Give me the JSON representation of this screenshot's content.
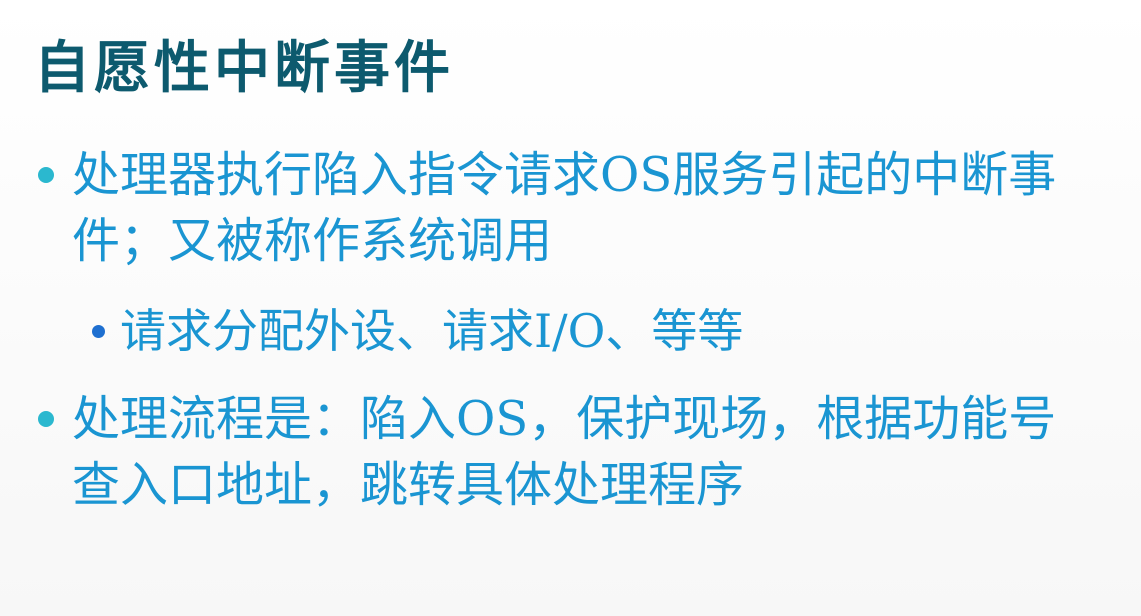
{
  "slide": {
    "title": "自愿性中断事件",
    "bullets": [
      {
        "level": 1,
        "text": "处理器执行陷入指令请求OS服务引起的中断事件；又被称作系统调用"
      },
      {
        "level": 2,
        "text": "请求分配外设、请求I/O、等等"
      },
      {
        "level": 1,
        "text": "处理流程是：陷入OS，保护现场，根据功能号查入口地址，跳转具体处理程序"
      }
    ]
  },
  "colors": {
    "title": "#0d5a6e",
    "body_text": "#1a95d2",
    "bullet_level1": "#2bb8cf",
    "bullet_level2": "#1e6fd0"
  }
}
